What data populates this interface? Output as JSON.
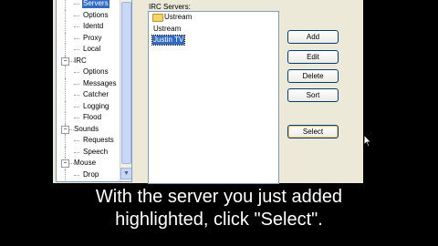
{
  "tree": {
    "items": [
      {
        "label": "Servers",
        "level": "child",
        "selected": true
      },
      {
        "label": "Options",
        "level": "child"
      },
      {
        "label": "Identd",
        "level": "child"
      },
      {
        "label": "Proxy",
        "level": "child"
      },
      {
        "label": "Local",
        "level": "child"
      },
      {
        "label": "IRC",
        "level": "parent",
        "expander": "−"
      },
      {
        "label": "Options",
        "level": "child"
      },
      {
        "label": "Messages",
        "level": "child"
      },
      {
        "label": "Catcher",
        "level": "child"
      },
      {
        "label": "Logging",
        "level": "child"
      },
      {
        "label": "Flood",
        "level": "child"
      },
      {
        "label": "Sounds",
        "level": "parent",
        "expander": "−"
      },
      {
        "label": "Requests",
        "level": "child"
      },
      {
        "label": "Speech",
        "level": "child"
      },
      {
        "label": "Mouse",
        "level": "parent",
        "expander": "−"
      },
      {
        "label": "Drop",
        "level": "child"
      }
    ],
    "scroll_down_glyph": "▼"
  },
  "servers": {
    "label": "IRC Servers:",
    "items": [
      {
        "label": "Ustream",
        "type": "folder"
      },
      {
        "label": "Ustream",
        "type": "item"
      },
      {
        "label": "Justin TV",
        "type": "item",
        "selected": true
      }
    ]
  },
  "buttons": {
    "add": "Add",
    "edit": "Edit",
    "delete": "Delete",
    "sort": "Sort",
    "select": "Select"
  },
  "caption": {
    "line1": "With the server you just added",
    "line2": "highlighted, click \"Select\"."
  },
  "colors": {
    "selection": "#316ac5",
    "dialog_bg": "#ece9d8",
    "button_border": "#003c74"
  }
}
